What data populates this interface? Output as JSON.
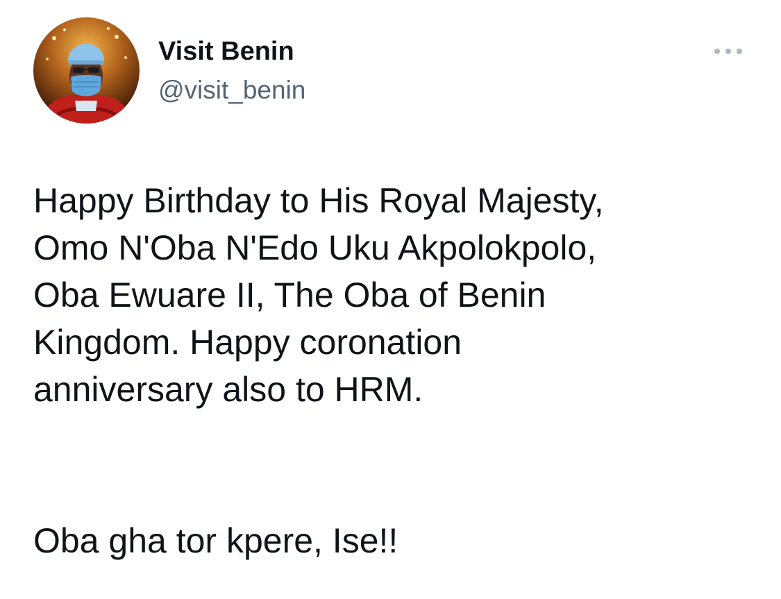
{
  "tweet": {
    "author": {
      "display_name": "Visit Benin",
      "handle": "@visit_benin",
      "avatar_icon": "avatar-photo"
    },
    "menu_icon": "more-horizontal-icon",
    "body_lines": [
      "Happy Birthday to His Royal Majesty,",
      "Omo N'Oba N'Edo Uku Akpolokpolo,",
      "Oba Ewuare II, The Oba of Benin",
      "Kingdom. Happy coronation",
      "anniversary also to HRM."
    ],
    "body_paragraph_2": "Oba gha tor kpere, Ise!!"
  },
  "colors": {
    "text_primary": "#0f1419",
    "text_secondary": "#536471",
    "menu_dots": "#aab8c2"
  }
}
